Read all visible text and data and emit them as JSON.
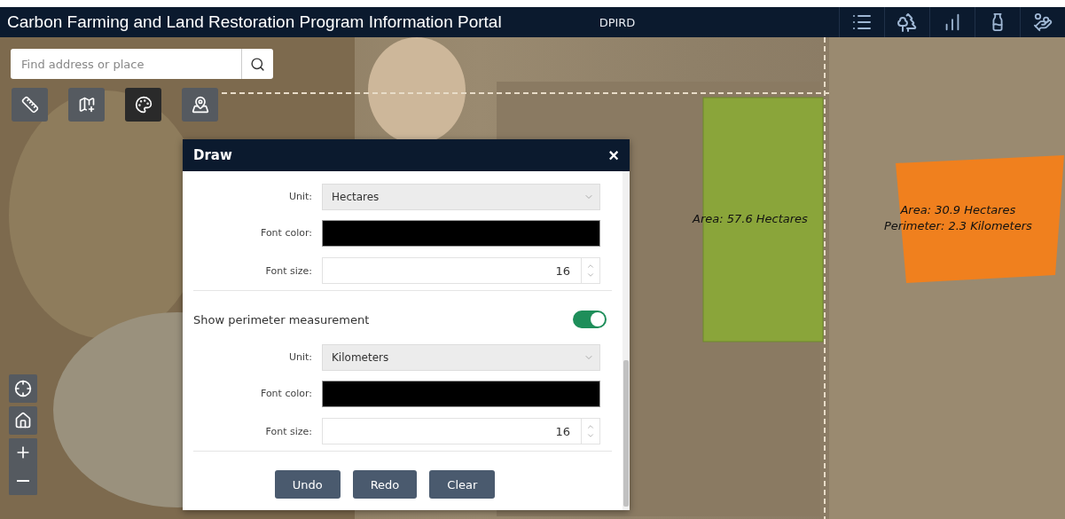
{
  "header": {
    "title": "Carbon Farming and Land Restoration Program Information Portal",
    "agency": "DPIRD"
  },
  "search": {
    "placeholder": "Find address or place"
  },
  "tools": [
    {
      "kind": "ruler",
      "selected": false
    },
    {
      "kind": "map-add",
      "selected": false
    },
    {
      "kind": "palette",
      "selected": true
    },
    {
      "kind": "pin",
      "selected": false
    }
  ],
  "map": {
    "field_label": "Area: 57.6 Hectares",
    "polygon_labels": [
      "Area: 30.9 Hectares",
      "Perimeter: 2.3 Kilometers"
    ]
  },
  "dialog": {
    "title": "Draw",
    "close": "×",
    "rows": [
      {
        "kind": "select",
        "label": "Unit:",
        "value": "Hectares"
      },
      {
        "kind": "color",
        "label": "Font color:",
        "color": "#000000"
      },
      {
        "kind": "number",
        "label": "Font size:",
        "value": "16"
      },
      {
        "kind": "toggle",
        "label": "Show perimeter measurement",
        "on": true
      },
      {
        "kind": "select",
        "label": "Unit:",
        "value": "Kilometers"
      },
      {
        "kind": "color",
        "label": "Font color:",
        "color": "#000000"
      },
      {
        "kind": "number",
        "label": "Font size:",
        "value": "16"
      }
    ],
    "buttons": [
      "Undo",
      "Redo",
      "Clear"
    ]
  }
}
